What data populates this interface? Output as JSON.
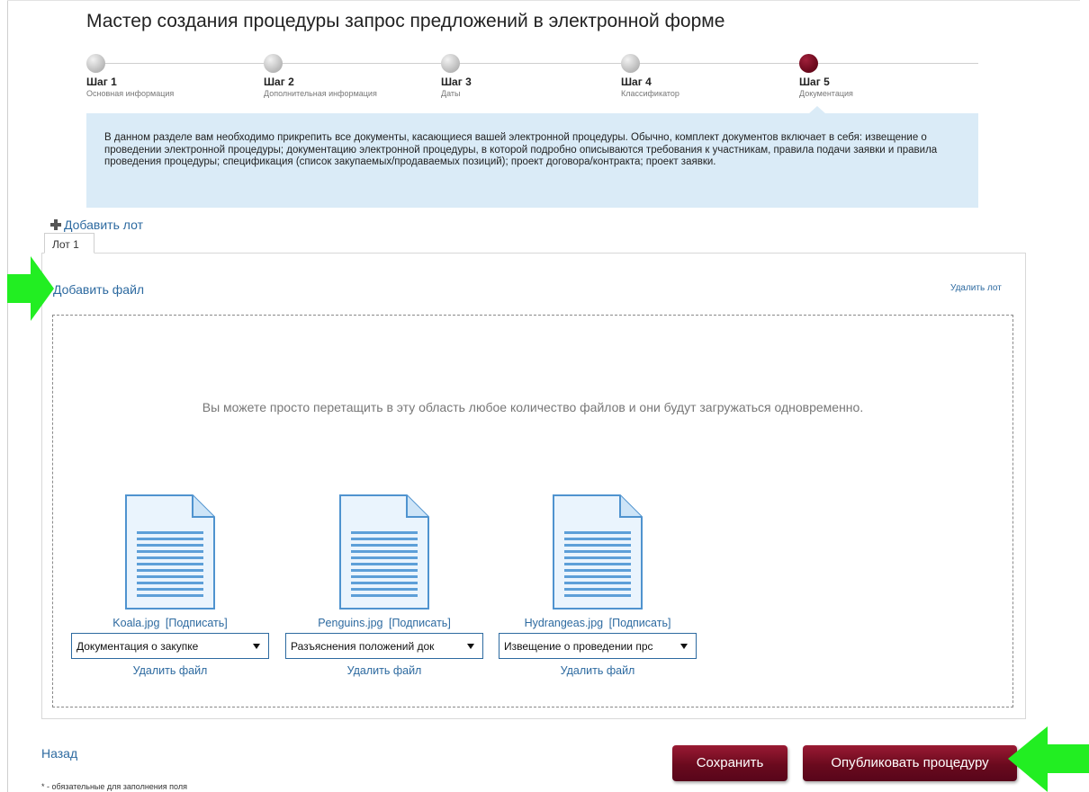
{
  "wizard": {
    "title": "Мастер создания процедуры запрос предложений в электронной форме",
    "steps": [
      {
        "name": "Шаг 1",
        "sub": "Основная информация",
        "active": false
      },
      {
        "name": "Шаг 2",
        "sub": "Дополнительная информация",
        "active": false
      },
      {
        "name": "Шаг 3",
        "sub": "Даты",
        "active": false
      },
      {
        "name": "Шаг 4",
        "sub": "Классификатор",
        "active": false
      },
      {
        "name": "Шаг 5",
        "sub": "Документация",
        "active": true
      }
    ],
    "info_text": "В данном разделе вам необходимо прикрепить все документы, касающиеся вашей электронной процедуры. Обычно, комплект документов включает в себя: извещение о проведении электронной процедуры; документацию электронной процедуры, в которой подробно описываются требования к участникам, правила подачи заявки и правила проведения процедуры; спецификация (список закупаемых/продаваемых позиций); проект договора/контракта; проект заявки."
  },
  "lots": {
    "add_lot_label": "Добавить лот",
    "tab_label": "Лот 1",
    "add_file_label": "Добавить файл",
    "delete_lot_label": "Удалить лот",
    "drop_hint": "Вы можете просто перетащить в эту область любое количество файлов и они будут загружаться одновременно."
  },
  "files": [
    {
      "name": "Koala.jpg",
      "sign_label": "[Подписать]",
      "doc_type": "Документация о закупке",
      "delete_label": "Удалить файл"
    },
    {
      "name": "Penguins.jpg",
      "sign_label": "[Подписать]",
      "doc_type": "Разъяснения положений док",
      "delete_label": "Удалить файл"
    },
    {
      "name": "Hydrangeas.jpg",
      "sign_label": "[Подписать]",
      "doc_type": "Извещение о проведении прс",
      "delete_label": "Удалить файл"
    }
  ],
  "footer": {
    "back_label": "Назад",
    "required_note": "* - обязательные для заполнения поля",
    "save_label": "Сохранить",
    "publish_label": "Опубликовать процедуру"
  },
  "colors": {
    "accent": "#6e0a1e",
    "link": "#2d6aa0",
    "info_bg": "#daebf7",
    "highlight_arrow": "#22ee22"
  },
  "icons": {
    "add": "plus-icon",
    "file": "document-icon",
    "dropdown": "chevron-down-icon",
    "annotation": "green-arrow-icon"
  }
}
